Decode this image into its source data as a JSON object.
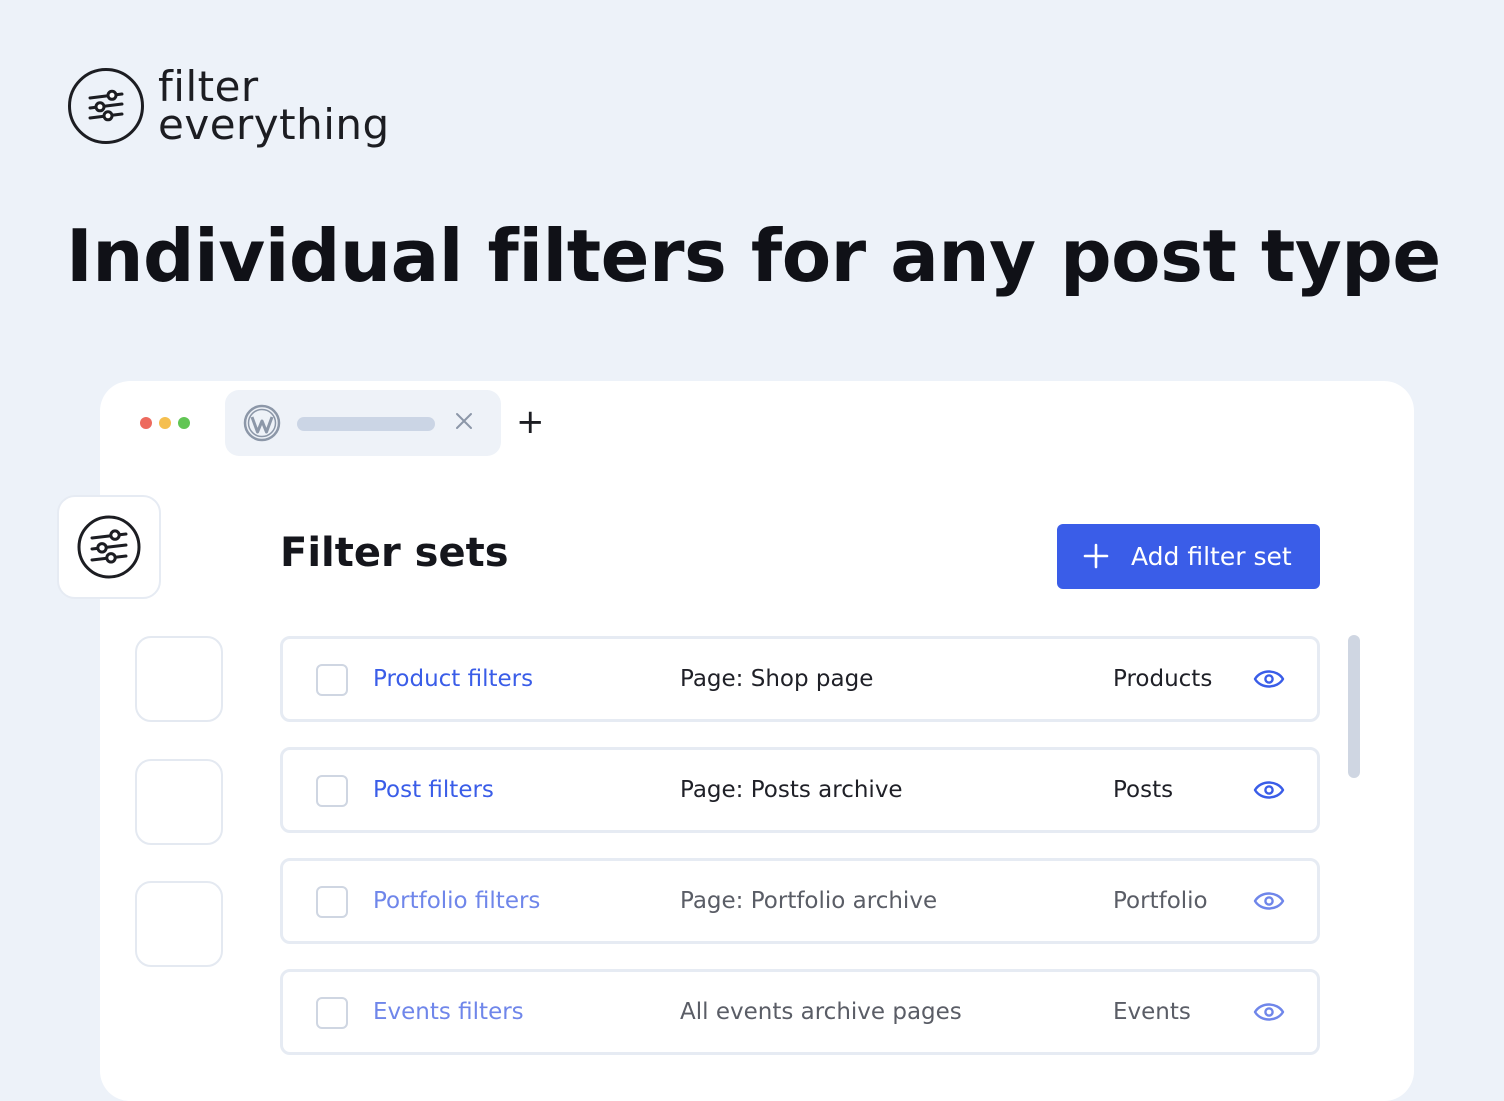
{
  "brand": {
    "line1": "filter",
    "line2": "everything",
    "logo_icon": "sliders-icon"
  },
  "headline": "Individual filters for any post type",
  "window": {
    "dots": [
      "#ed6a5e",
      "#f5bf4f",
      "#61c554"
    ],
    "tab_icon": "wordpress-icon",
    "new_tab_symbol": "+"
  },
  "page": {
    "title": "Filter sets",
    "add_button_label": "Add filter set",
    "accent": "#3a5de8"
  },
  "filter_sets": [
    {
      "name": "Product filters",
      "location": "Page: Shop page",
      "post_type": "Products"
    },
    {
      "name": "Post filters",
      "location": "Page: Posts archive",
      "post_type": "Posts"
    },
    {
      "name": "Portfolio filters",
      "location": "Page: Portfolio archive",
      "post_type": "Portfolio"
    },
    {
      "name": "Events filters",
      "location": "All events archive pages",
      "post_type": "Events"
    }
  ]
}
